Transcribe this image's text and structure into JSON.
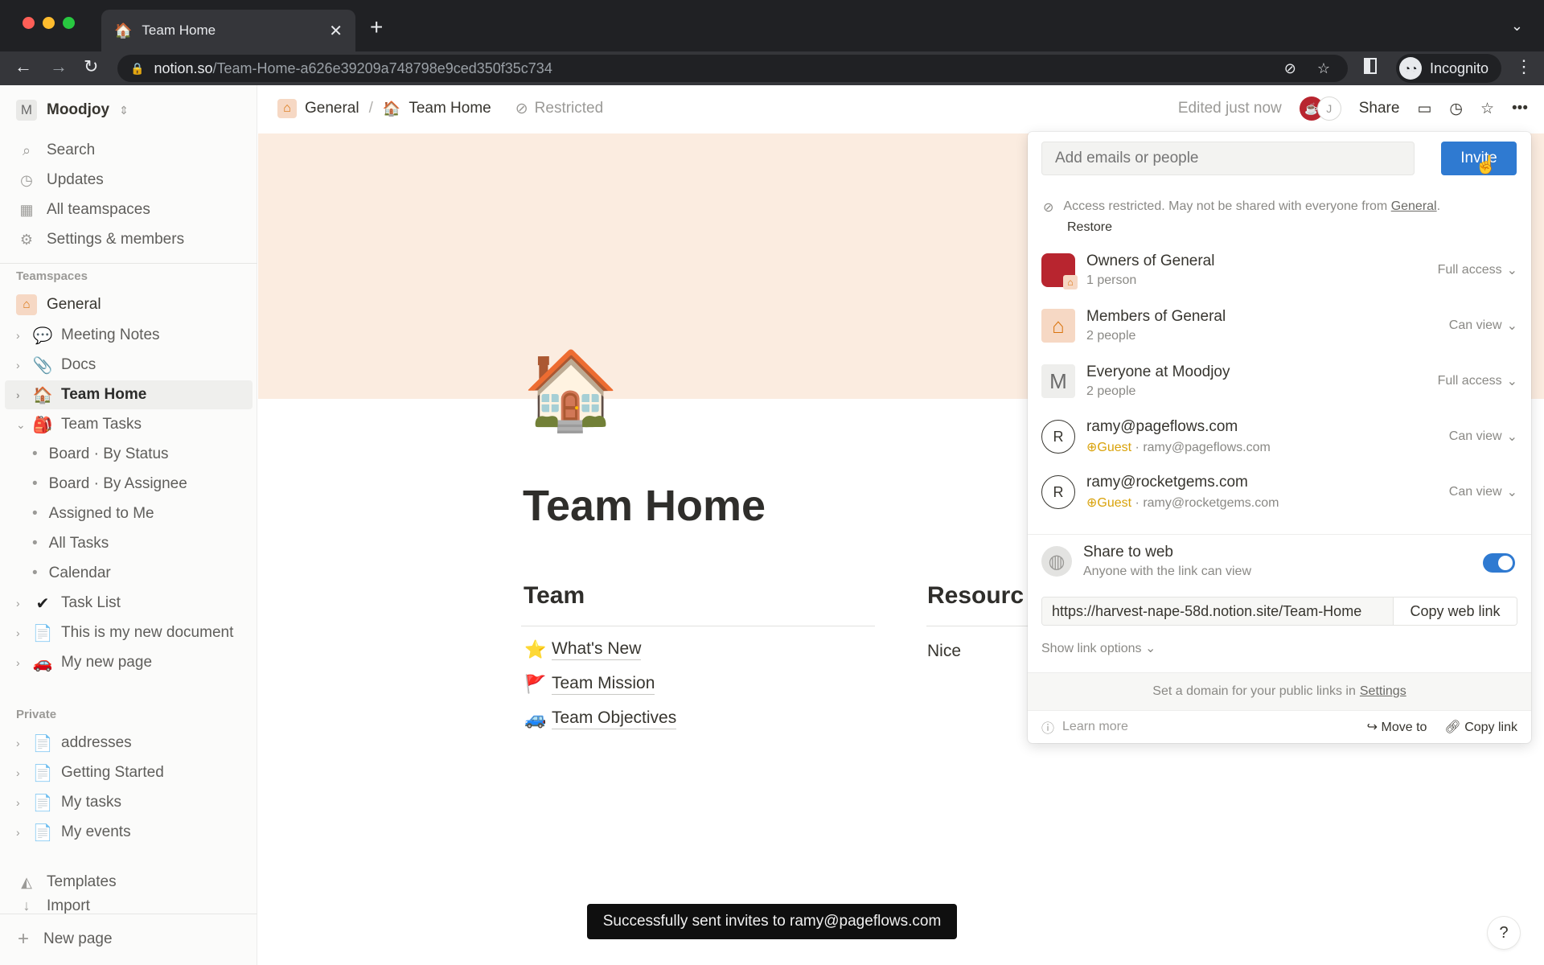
{
  "browser": {
    "tab_title": "Team Home",
    "tab_icon": "🏠",
    "url_host": "notion.so",
    "url_path": "/Team-Home-a626e39209a748798e9ced350f35c734",
    "profile_label": "Incognito"
  },
  "workspace": {
    "initial": "M",
    "name": "Moodjoy"
  },
  "sidebar": {
    "nav": [
      {
        "label": "Search",
        "icon": "search-icon"
      },
      {
        "label": "Updates",
        "icon": "clock-icon"
      },
      {
        "label": "All teamspaces",
        "icon": "building-icon"
      },
      {
        "label": "Settings & members",
        "icon": "gear-icon"
      }
    ],
    "teamspaces_heading": "Teamspaces",
    "teamspace": {
      "label": "General",
      "icon": "🏠"
    },
    "team_pages": [
      {
        "label": "Meeting Notes",
        "emoji": "💬"
      },
      {
        "label": "Docs",
        "emoji": "📎"
      },
      {
        "label": "Team Home",
        "emoji": "🏠",
        "selected": true
      },
      {
        "label": "Team Tasks",
        "emoji": "🎒",
        "expanded": true
      }
    ],
    "team_tasks_views": [
      "Board · By Status",
      "Board · By Assignee",
      "Assigned to Me",
      "All Tasks",
      "Calendar"
    ],
    "more_pages": [
      {
        "label": "Task List",
        "emoji": "✔"
      },
      {
        "label": "This is my new document",
        "emoji": "📄"
      },
      {
        "label": "My new page",
        "emoji": "🚗"
      }
    ],
    "private_heading": "Private",
    "private_pages": [
      {
        "label": "addresses"
      },
      {
        "label": "Getting Started"
      },
      {
        "label": "My tasks"
      },
      {
        "label": "My events"
      }
    ],
    "templates_label": "Templates",
    "import_label": "Import",
    "new_page_label": "New page"
  },
  "topbar": {
    "breadcrumb": [
      {
        "label": "General",
        "icon": "🏠"
      },
      {
        "label": "Team Home",
        "icon": "🏠"
      }
    ],
    "restricted_label": "Restricted",
    "edited_label": "Edited just now",
    "avatar_j": "J",
    "share_label": "Share"
  },
  "page": {
    "icon": "🏠",
    "title": "Team Home",
    "team_heading": "Team",
    "resources_heading": "Resourc",
    "team_links": [
      {
        "emoji": "⭐",
        "label": "What's New"
      },
      {
        "emoji": "🚩",
        "label": "Team Mission"
      },
      {
        "emoji": "🚙",
        "label": "Team Objectives"
      }
    ],
    "resources_text": "Nice"
  },
  "share_panel": {
    "invite_placeholder": "Add emails or people",
    "invite_label": "Invite",
    "access_text": "Access restricted. May not be shared with everyone from ",
    "access_link": "General",
    "restore_label": "Restore",
    "people": [
      {
        "name": "Owners of General",
        "sub": "1 person",
        "permission": "Full access"
      },
      {
        "name": "Members of General",
        "sub": "2 people",
        "permission": "Can view"
      },
      {
        "name": "Everyone at Moodjoy",
        "sub": "2 people",
        "permission": "Full access",
        "initial": "M"
      },
      {
        "name": "ramy@pageflows.com",
        "badge": "Guest",
        "sub": "ramy@pageflows.com",
        "permission": "Can view",
        "initial": "R"
      },
      {
        "name": "ramy@rocketgems.com",
        "badge": "Guest",
        "sub": "ramy@rocketgems.com",
        "permission": "Can view",
        "initial": "R"
      }
    ],
    "share_web_title": "Share to web",
    "share_web_sub": "Anyone with the link can view",
    "share_web_enabled": true,
    "web_url": "https://harvest-nape-58d.notion.site/Team-Home",
    "copy_web_link_label": "Copy web link",
    "show_link_options_label": "Show link options",
    "domain_text": "Set a domain for your public links in",
    "domain_link": "Settings",
    "learn_more_label": "Learn more",
    "move_to_label": "Move to",
    "copy_link_label": "Copy link"
  },
  "toast": "Successfully sent invites to ramy@pageflows.com",
  "help_label": "?",
  "colors": {
    "accent": "#2f7ad1",
    "cover": "#fbece0",
    "guest": "#d9a20a",
    "teamspace": "#d9730d"
  }
}
